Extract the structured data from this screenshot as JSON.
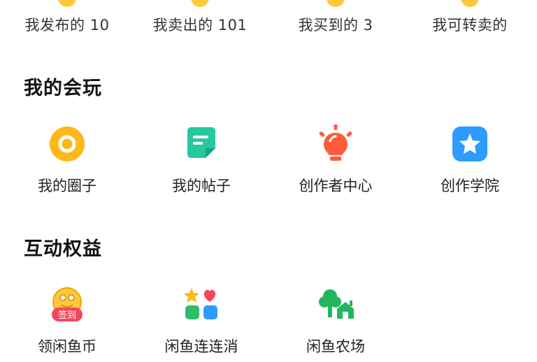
{
  "stats": [
    {
      "label": "我发布的 10",
      "color": "#FFC83D"
    },
    {
      "label": "我卖出的 101",
      "color": "#FFC83D"
    },
    {
      "label": "我买到的 3",
      "color": "#FFC83D"
    },
    {
      "label": "我可转卖的",
      "color": "#FFC83D"
    }
  ],
  "play": {
    "title": "我的会玩",
    "items": [
      {
        "label": "我的圈子",
        "icon": "circle-ring-icon",
        "color": "#FFB81A"
      },
      {
        "label": "我的帖子",
        "icon": "post-icon",
        "color": "#25C8A0"
      },
      {
        "label": "创作者中心",
        "icon": "lightbulb-icon",
        "color": "#FF5A3C"
      },
      {
        "label": "创作学院",
        "icon": "star-badge-icon",
        "color": "#2E9BFF"
      }
    ]
  },
  "benefits": {
    "title": "互动权益",
    "items": [
      {
        "label": "领闲鱼币",
        "icon": "sign-in-coin-icon",
        "badge": "签到"
      },
      {
        "label": "闲鱼连连消",
        "icon": "match-game-icon"
      },
      {
        "label": "闲鱼农场",
        "icon": "farm-icon"
      }
    ]
  }
}
